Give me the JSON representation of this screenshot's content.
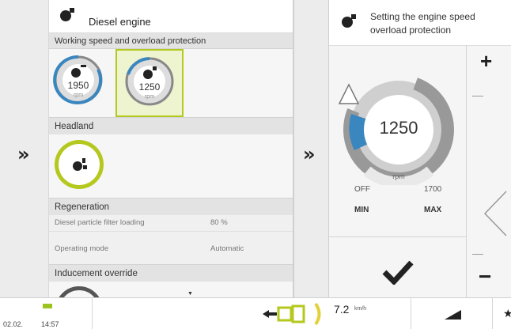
{
  "left_panel": {
    "title": "Diesel engine",
    "working_speed": {
      "title": "Working speed and overload protection",
      "gauge1": {
        "value": "1950",
        "unit": "rpm"
      },
      "gauge2": {
        "value": "1250",
        "unit": "rpm"
      }
    },
    "headland": {
      "title": "Headland"
    },
    "regeneration": {
      "title": "Regeneration",
      "dpf_label": "Diesel particle filter loading",
      "dpf_value": "80 %",
      "mode_label": "Operating mode",
      "mode_value": "Automatic"
    },
    "inducement": {
      "title": "Inducement override"
    }
  },
  "right_panel": {
    "title_line1": "Setting the engine speed",
    "title_line2": "overload protection",
    "gauge": {
      "value": "1250",
      "unit": "rpm"
    },
    "min_value": "OFF",
    "max_value": "1700",
    "min_label": "MIN",
    "max_label": "MAX",
    "plus": "+",
    "minus": "−"
  },
  "bottom_bar": {
    "date": "02.02.",
    "time": "14:57",
    "speed_value": "7.2",
    "speed_unit": "km/h"
  },
  "colors": {
    "accent_blue": "#3a86bf",
    "accent_green": "#b4c81e",
    "gauge_gray": "#9a9a9a"
  }
}
